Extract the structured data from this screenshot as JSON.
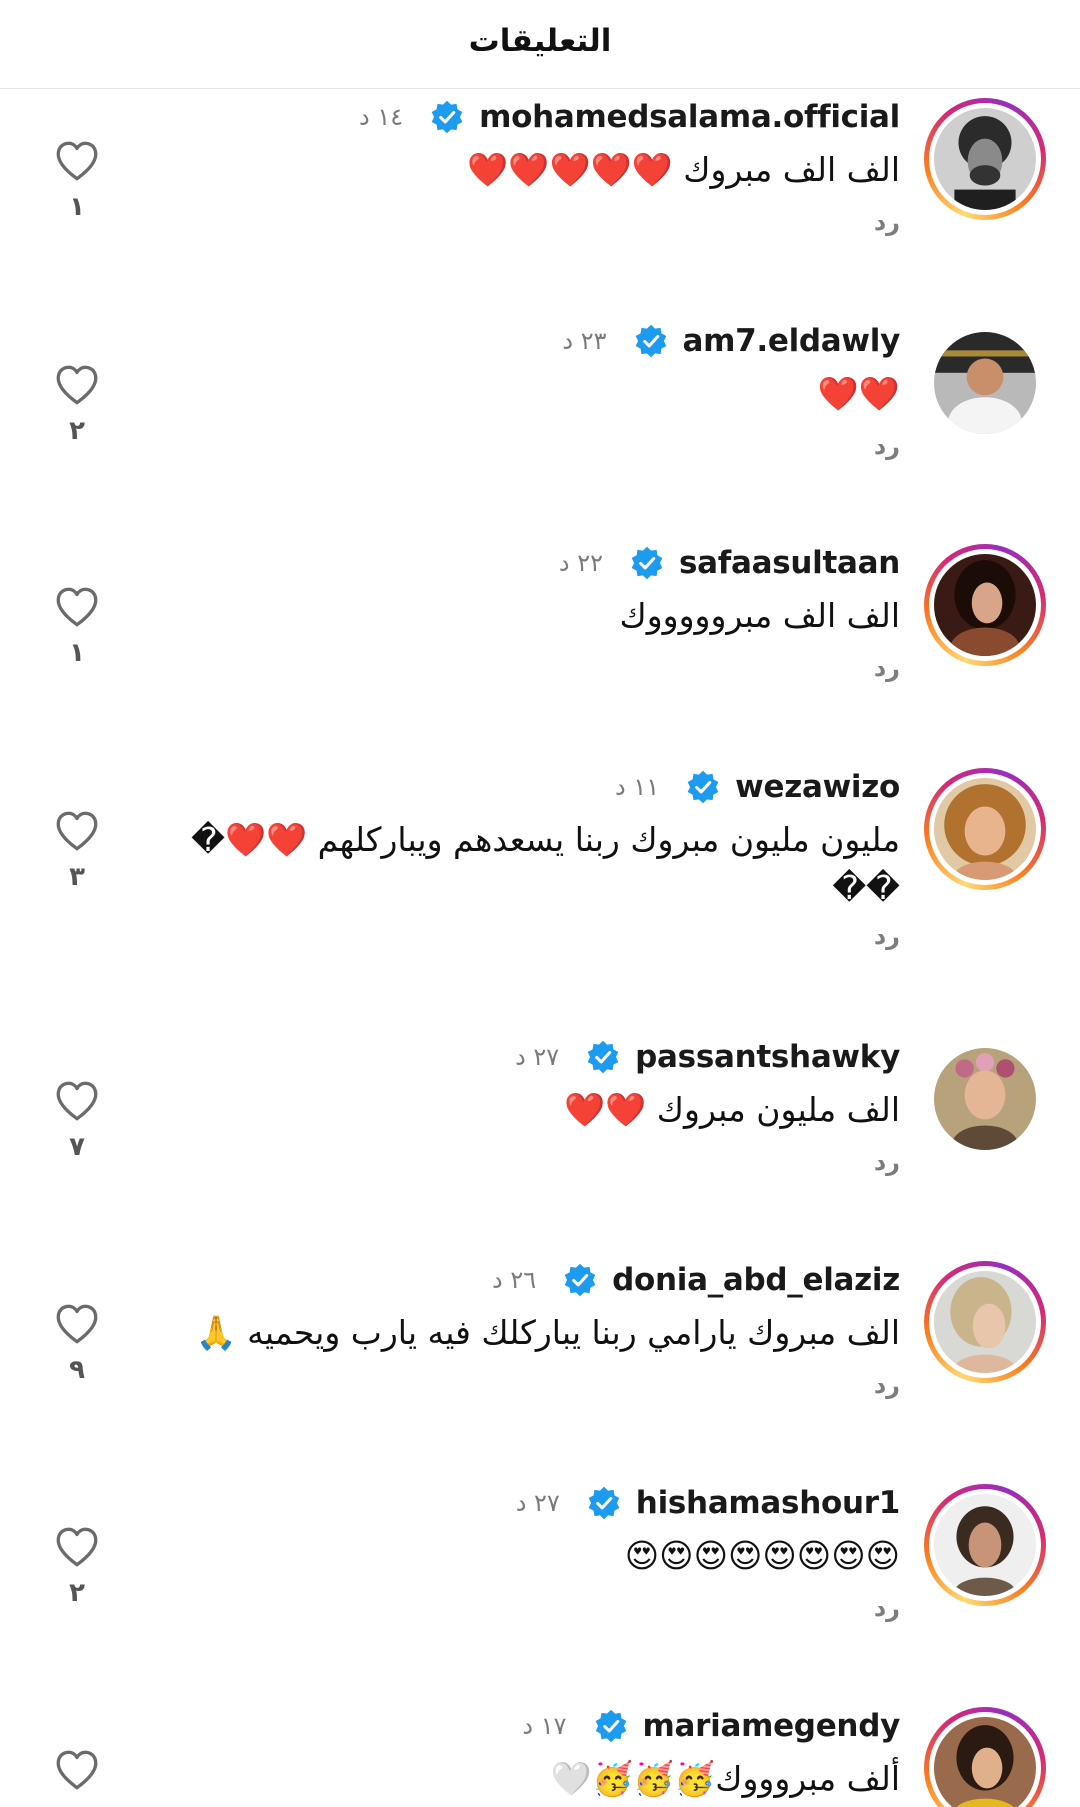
{
  "header": {
    "title": "التعليقات"
  },
  "reply_label": "رد",
  "colors": {
    "verified": "#1d9bf0",
    "text": "#111111",
    "muted": "#7a7a7a"
  },
  "comments": [
    {
      "username": "mohamedsalama.official",
      "time": "١٤ د",
      "text": "الف الف مبروك ❤️❤️❤️❤️❤️",
      "likes": "١",
      "story_ring": true,
      "verified": true
    },
    {
      "username": "am7.eldawly",
      "time": "٢٣ د",
      "text": "❤️❤️",
      "likes": "٢",
      "story_ring": false,
      "verified": true
    },
    {
      "username": "safaasultaan",
      "time": "٢٢ د",
      "text": "الف الف مبروووووك",
      "likes": "١",
      "story_ring": true,
      "verified": true
    },
    {
      "username": "wezawizo",
      "time": "١١ د",
      "text": "مليون مليون مبروك ربنا يسعدهم ويباركلهم ❤️❤️�\n��",
      "likes": "٣",
      "story_ring": true,
      "verified": true
    },
    {
      "username": "passantshawky",
      "time": "٢٧ د",
      "text": "الف مليون مبروك ❤️❤️",
      "likes": "٧",
      "story_ring": false,
      "verified": true
    },
    {
      "username": "donia_abd_elaziz",
      "time": "٢٦ د",
      "text": "الف مبروك يارامي ربنا يباركلك فيه يارب ويحميه 🙏",
      "likes": "٩",
      "story_ring": true,
      "verified": true
    },
    {
      "username": "hishamashour1",
      "time": "٢٧ د",
      "text": "😍😍😍😍😍😍😍😍",
      "likes": "٢",
      "story_ring": true,
      "verified": true
    },
    {
      "username": "mariamegendy",
      "time": "١٧ د",
      "text": "ألف مبروووك🥳🥳🥳🤍",
      "likes": "",
      "story_ring": true,
      "verified": true
    }
  ]
}
